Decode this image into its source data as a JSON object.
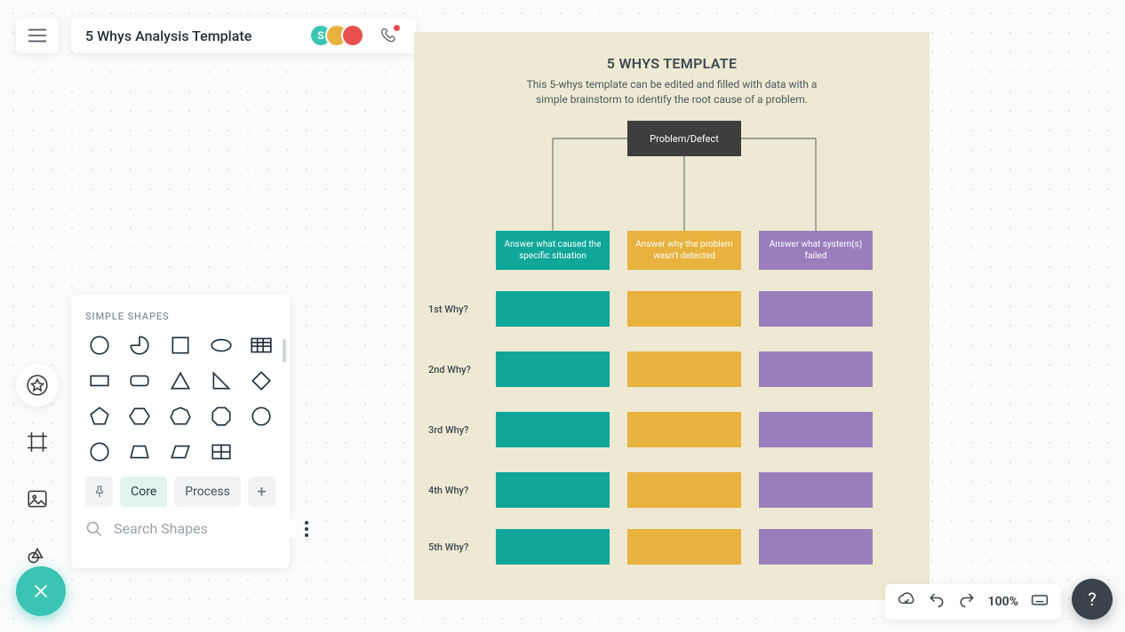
{
  "header": {
    "title": "5 Whys Analysis Template",
    "avatars": [
      {
        "label": "S",
        "bg": "#3ac4b4"
      },
      {
        "label": "",
        "bg": "#e8b23e"
      },
      {
        "label": "",
        "bg": "#e7504e"
      }
    ]
  },
  "shapes_panel": {
    "heading": "SIMPLE SHAPES",
    "tabs": {
      "pin": "pin",
      "core": "Core",
      "process": "Process",
      "add": "+"
    },
    "search_placeholder": "Search Shapes"
  },
  "diagram": {
    "title": "5 WHYS TEMPLATE",
    "subtitle": "This 5-whys template can be edited and filled with data with a simple brainstorm to identify the root cause of a problem.",
    "problem_box": "Problem/Defect",
    "columns": [
      "Answer what caused the specific situation",
      "Answer why the problem wasn't detected",
      "Answer what system(s) failed"
    ],
    "rows": [
      "1st Why?",
      "2nd Why?",
      "3rd Why?",
      "4th Why?",
      "5th Why?"
    ]
  },
  "status": {
    "zoom": "100%",
    "help": "?"
  }
}
